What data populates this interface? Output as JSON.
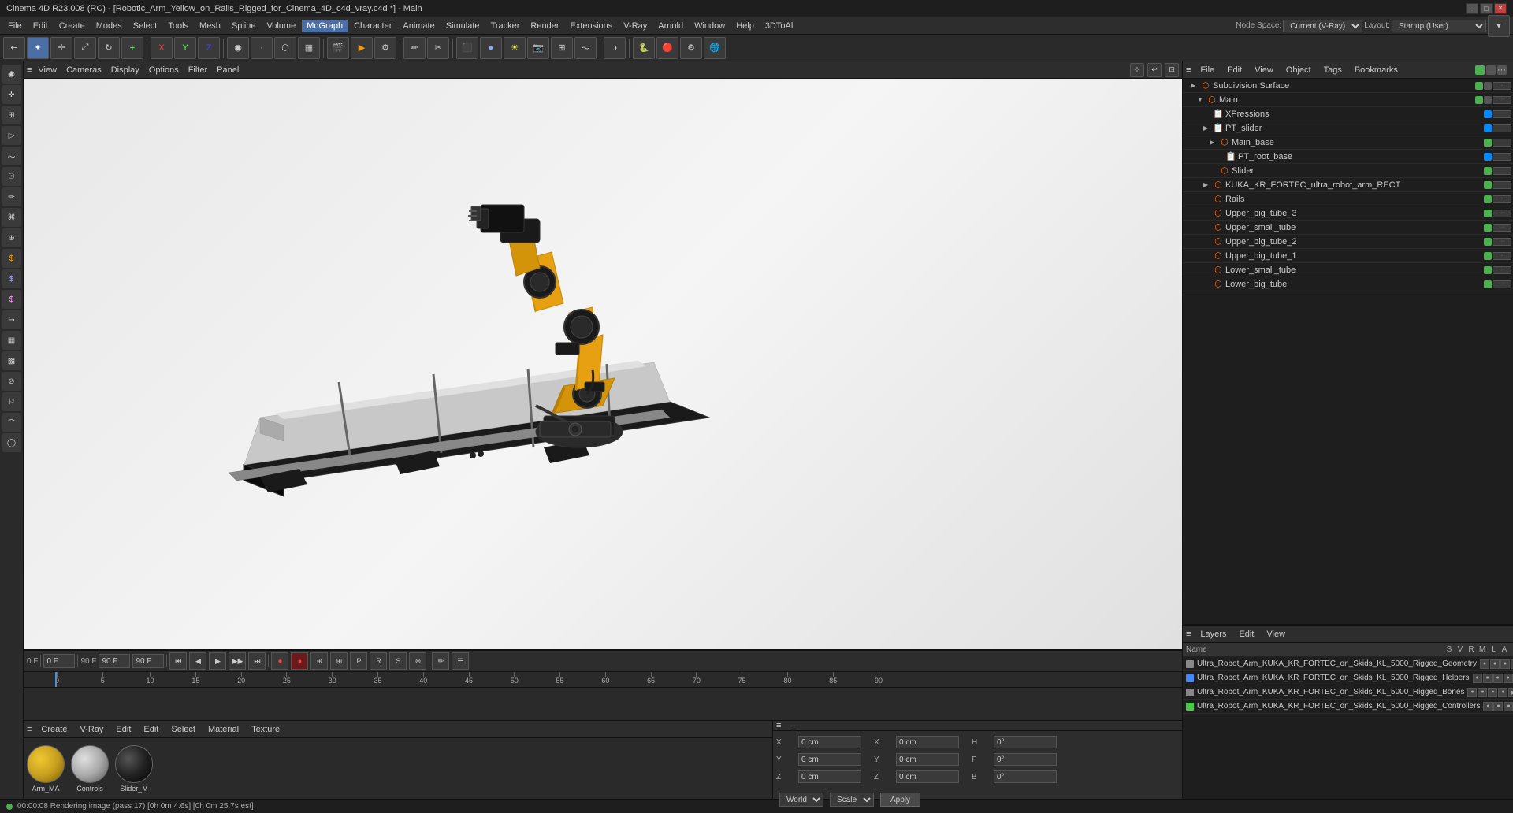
{
  "titlebar": {
    "title": "Cinema 4D R23.008 (RC) - [Robotic_Arm_Yellow_on_Rails_Rigged_for_Cinema_4D_c4d_vray.c4d *] - Main",
    "min_btn": "─",
    "max_btn": "□",
    "close_btn": "✕"
  },
  "menubar": {
    "items": [
      "File",
      "Edit",
      "Create",
      "Modes",
      "Select",
      "Tools",
      "Mesh",
      "Spline",
      "Volume",
      "MoGraph",
      "Character",
      "Animate",
      "Simulate",
      "Tracker",
      "Render",
      "Extensions",
      "V-Ray",
      "Arnold",
      "Window",
      "Help",
      "3DToAll"
    ]
  },
  "toolbar_secondary": {
    "node_space_label": "Node Space:",
    "node_space_value": "Current (V-Ray)",
    "layout_label": "Layout:",
    "layout_value": "Startup (User)"
  },
  "viewport_menu": {
    "items": [
      "≡",
      "View",
      "Cameras",
      "Display",
      "Options",
      "Filter",
      "Panel"
    ]
  },
  "scene_tree": {
    "menu_items": [
      "File",
      "Edit",
      "View",
      "Object",
      "Tags",
      "Bookmarks"
    ],
    "items": [
      {
        "label": "Subdivision Surface",
        "indent": 0,
        "arrow": "▶",
        "icon_color": "#ff6600",
        "selected": false
      },
      {
        "label": "Main",
        "indent": 1,
        "arrow": "▼",
        "icon_color": "#ff6600",
        "selected": false
      },
      {
        "label": "XPressions",
        "indent": 2,
        "arrow": "",
        "icon_color": "#00aaff",
        "selected": false
      },
      {
        "label": "PT_slider",
        "indent": 2,
        "arrow": "▶",
        "icon_color": "#00aaff",
        "selected": false
      },
      {
        "label": "Main_base",
        "indent": 3,
        "arrow": "▶",
        "icon_color": "#ff6600",
        "selected": false
      },
      {
        "label": "PT_root_base",
        "indent": 4,
        "arrow": "",
        "icon_color": "#00aaff",
        "selected": false
      },
      {
        "label": "Slider",
        "indent": 3,
        "arrow": "",
        "icon_color": "#ff6600",
        "selected": false
      },
      {
        "label": "KUKA_KR_FORTEC_ultra_robot_arm_RECT",
        "indent": 2,
        "arrow": "▶",
        "icon_color": "#ff6600",
        "selected": false
      },
      {
        "label": "Rails",
        "indent": 2,
        "arrow": "",
        "icon_color": "#ff6600",
        "selected": false
      },
      {
        "label": "Upper_big_tube_3",
        "indent": 2,
        "arrow": "",
        "icon_color": "#ff6600",
        "selected": false
      },
      {
        "label": "Upper_small_tube",
        "indent": 2,
        "arrow": "",
        "icon_color": "#ff6600",
        "selected": false
      },
      {
        "label": "Upper_big_tube_2",
        "indent": 2,
        "arrow": "",
        "icon_color": "#ff6600",
        "selected": false
      },
      {
        "label": "Upper_big_tube_1",
        "indent": 2,
        "arrow": "",
        "icon_color": "#ff6600",
        "selected": false
      },
      {
        "label": "Lower_small_tube",
        "indent": 2,
        "arrow": "",
        "icon_color": "#ff6600",
        "selected": false
      },
      {
        "label": "Lower_big_tube",
        "indent": 2,
        "arrow": "",
        "icon_color": "#ff6600",
        "selected": false
      }
    ]
  },
  "layers": {
    "menu_items": [
      "Layers",
      "Edit",
      "View"
    ],
    "header": {
      "name_col": "Name",
      "s_col": "S",
      "v_col": "V",
      "r_col": "R",
      "m_col": "M",
      "l_col": "L",
      "a_col": "A"
    },
    "items": [
      {
        "name": "Ultra_Robot_Arm_KUKA_KR_FORTEC_on_Skids_KL_5000_Rigged_Geometry",
        "color": "#888888"
      },
      {
        "name": "Ultra_Robot_Arm_KUKA_KR_FORTEC_on_Skids_KL_5000_Rigged_Helpers",
        "color": "#4488ff"
      },
      {
        "name": "Ultra_Robot_Arm_KUKA_KR_FORTEC_on_Skids_KL_5000_Rigged_Bones",
        "color": "#888888"
      },
      {
        "name": "Ultra_Robot_Arm_KUKA_KR_FORTEC_on_Skids_KL_5000_Rigged_Controllers",
        "color": "#44cc44"
      }
    ]
  },
  "materials": {
    "menu_items": [
      "≡",
      "Create",
      "V-Ray",
      "Edit",
      "Edit",
      "Select",
      "Material",
      "Texture"
    ],
    "items": [
      {
        "label": "Arm_MA",
        "sphere_color": "#c8a020"
      },
      {
        "label": "Controls",
        "sphere_color": "#aaaaaa"
      },
      {
        "label": "Slider_M",
        "sphere_color": "#222222"
      }
    ]
  },
  "attributes": {
    "x_pos": "0 cm",
    "x_pos2": "0 cm",
    "h_val": "0°",
    "y_pos": "0 cm",
    "y_pos2": "0 cm",
    "p_val": "0°",
    "z_pos": "0 cm",
    "z_pos2": "0 cm",
    "b_val": "0°",
    "coord_mode": "World",
    "transform_mode": "Scale",
    "apply_btn": "Apply"
  },
  "timeline": {
    "start_frame": "0 F",
    "current_frame": "0 F",
    "end_frame": "90 F",
    "end_frame2": "90 F",
    "fps_val": "0 F",
    "ruler_marks": [
      0,
      5,
      10,
      15,
      20,
      25,
      30,
      35,
      40,
      45,
      50,
      55,
      60,
      65,
      70,
      75,
      80,
      85,
      90
    ]
  },
  "statusbar": {
    "status_text": "00:00:08 Rendering image (pass 17) [0h 0m 4.6s] [0h 0m 25.7s est]"
  },
  "icons": {
    "menu_icon": "≡",
    "arrow_right": "▶",
    "arrow_down": "▼",
    "play": "▶",
    "pause": "⏸",
    "stop": "⏹",
    "prev": "⏮",
    "next": "⏭",
    "record": "⏺",
    "rewind": "⏪",
    "forward": "⏩"
  }
}
